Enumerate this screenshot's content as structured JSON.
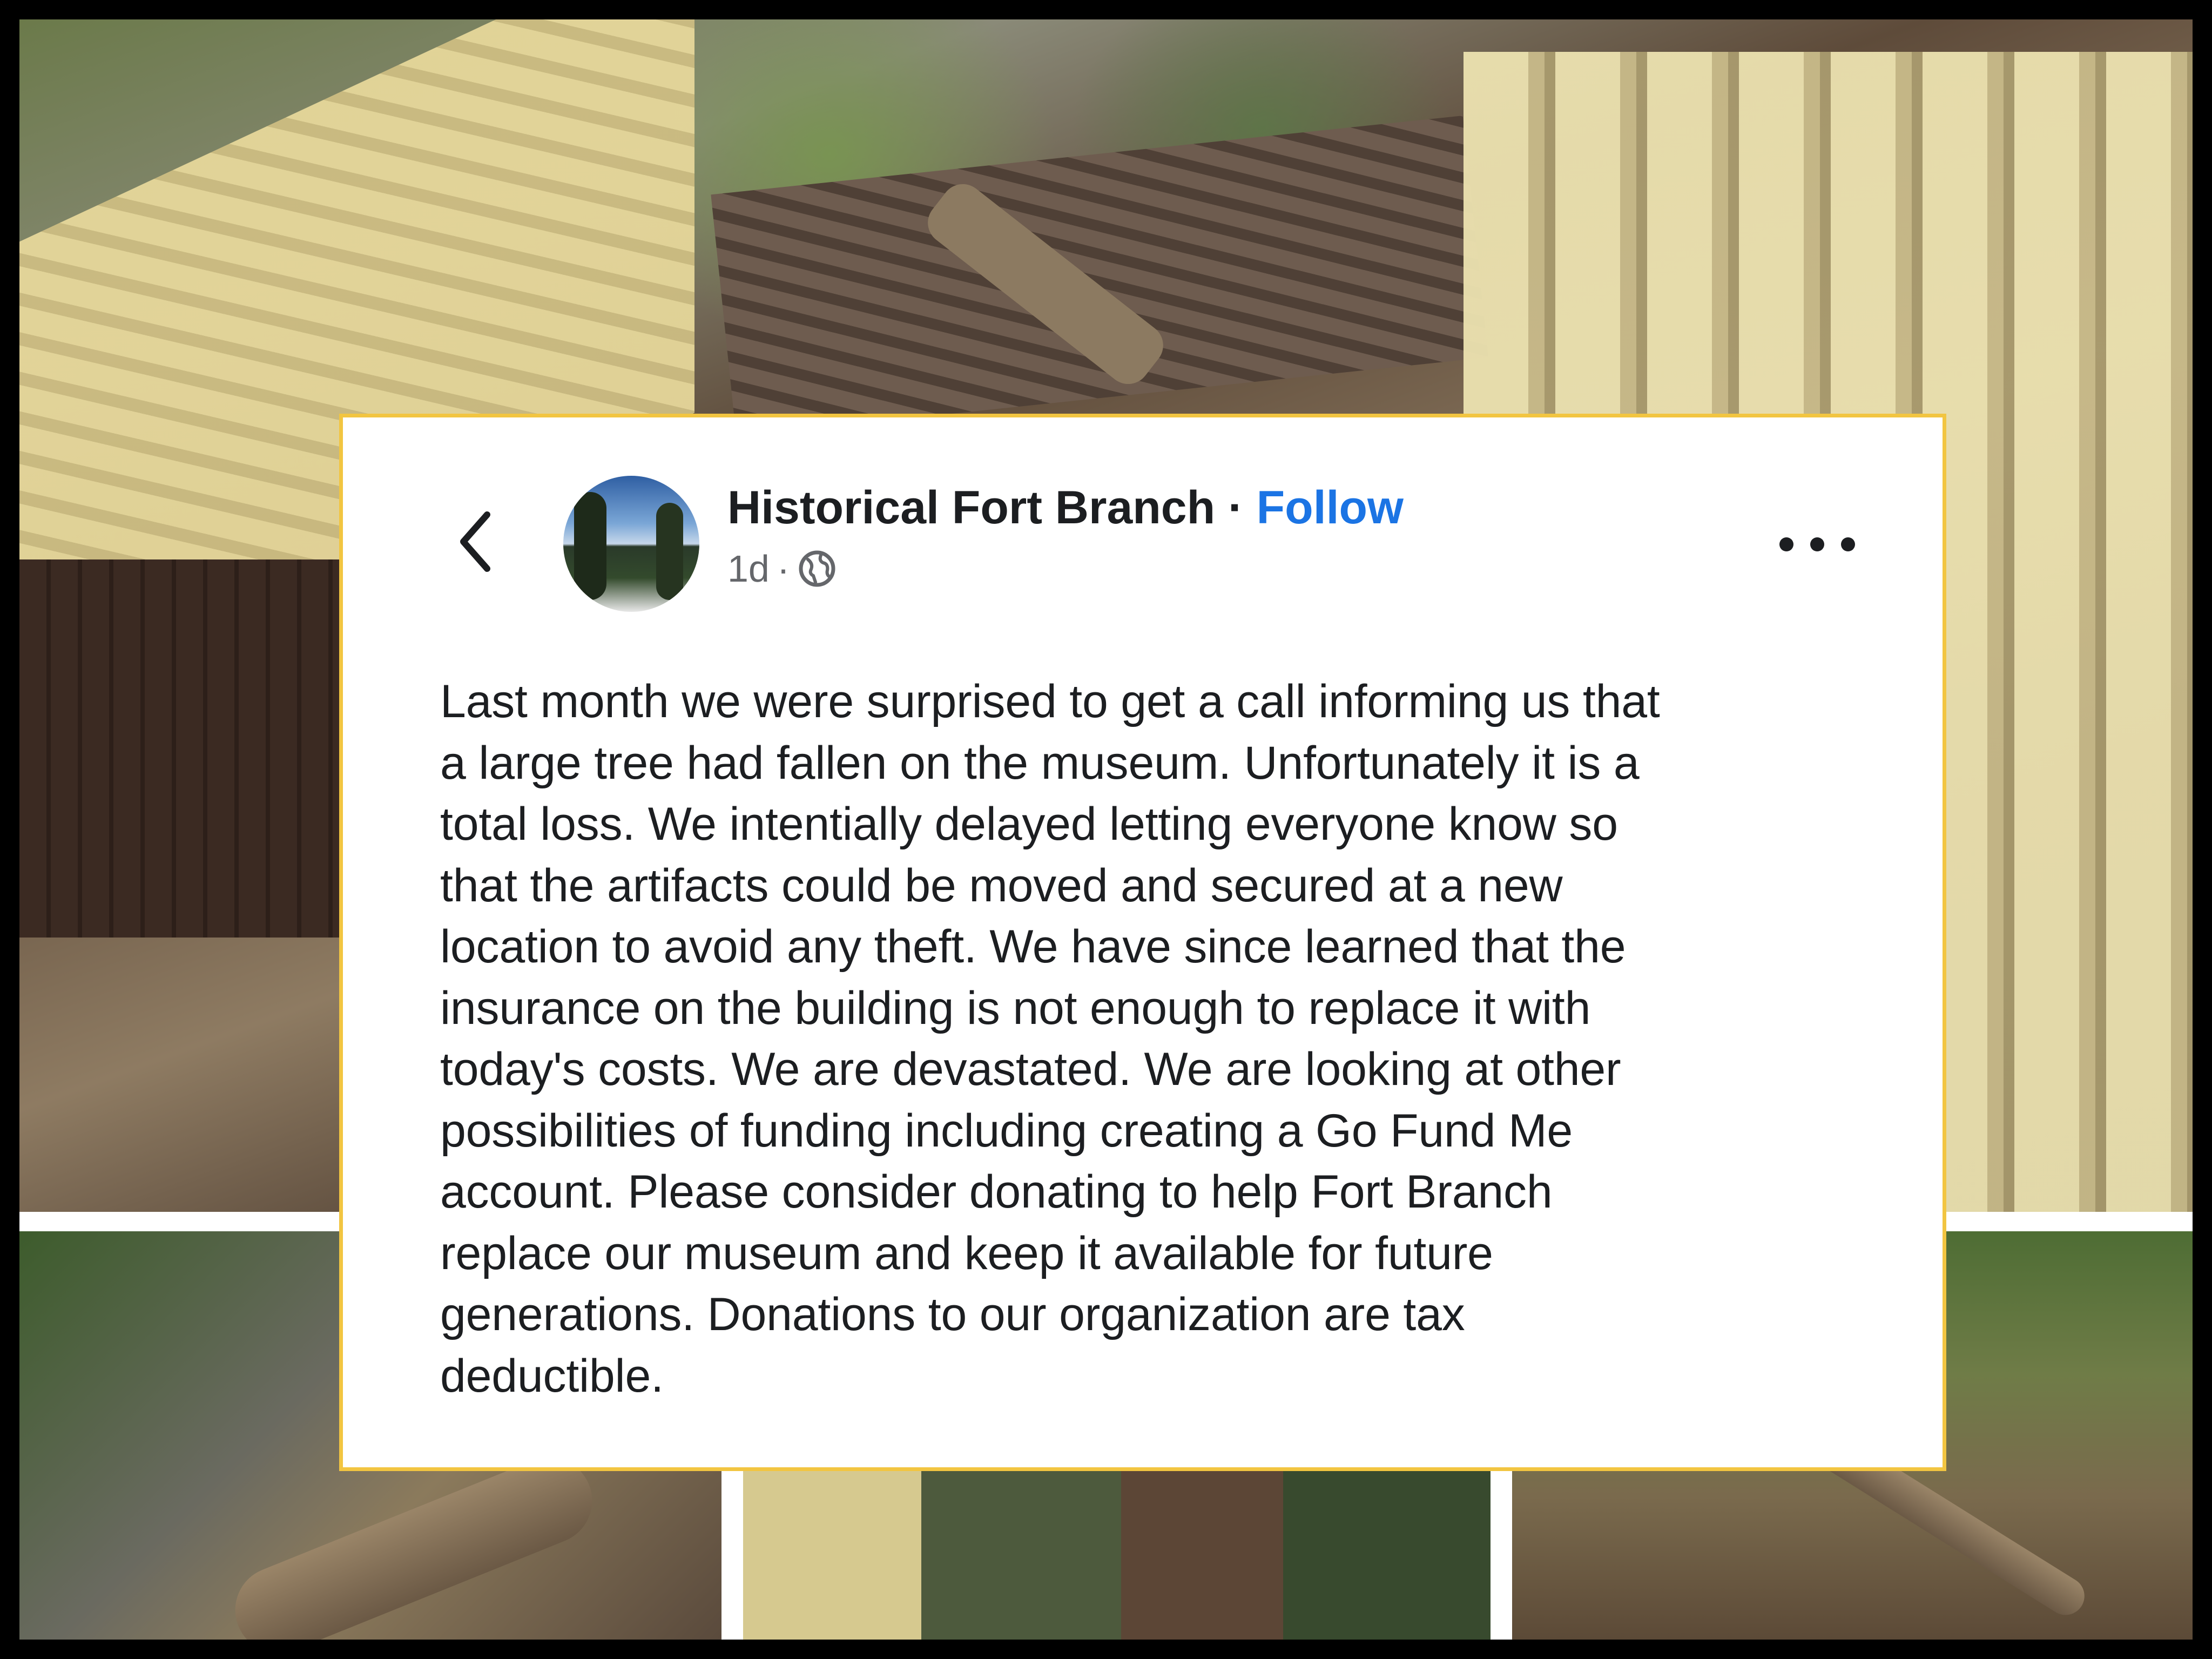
{
  "post": {
    "page_name": "Historical Fort Branch",
    "separator": "·",
    "follow_label": "Follow",
    "timestamp": "1d",
    "meta_separator": "·",
    "audience_icon": "globe-icon",
    "back_icon": "chevron-left-icon",
    "more_icon": "more-horizontal-icon",
    "body": "Last month we were surprised to get a call informing us that\na large tree had fallen on the museum. Unfortunately it is a\ntotal loss. We intentially delayed letting everyone know so\nthat the artifacts could be moved and secured at a new\nlocation to avoid any theft. We have since learned that the\ninsurance on the building is not enough to replace it with\ntoday's costs. We are devastated. We are looking at other\npossibilities of funding including creating a Go Fund Me\naccount. Please consider donating to help Fort Branch\nreplace our museum and keep it available for future\ngenerations. Donations to our organization are tax\ndeductible."
  },
  "colors": {
    "follow": "#1b74e4",
    "card_border": "#f2c541",
    "text": "#1c1e21",
    "meta_text": "#65676b"
  }
}
